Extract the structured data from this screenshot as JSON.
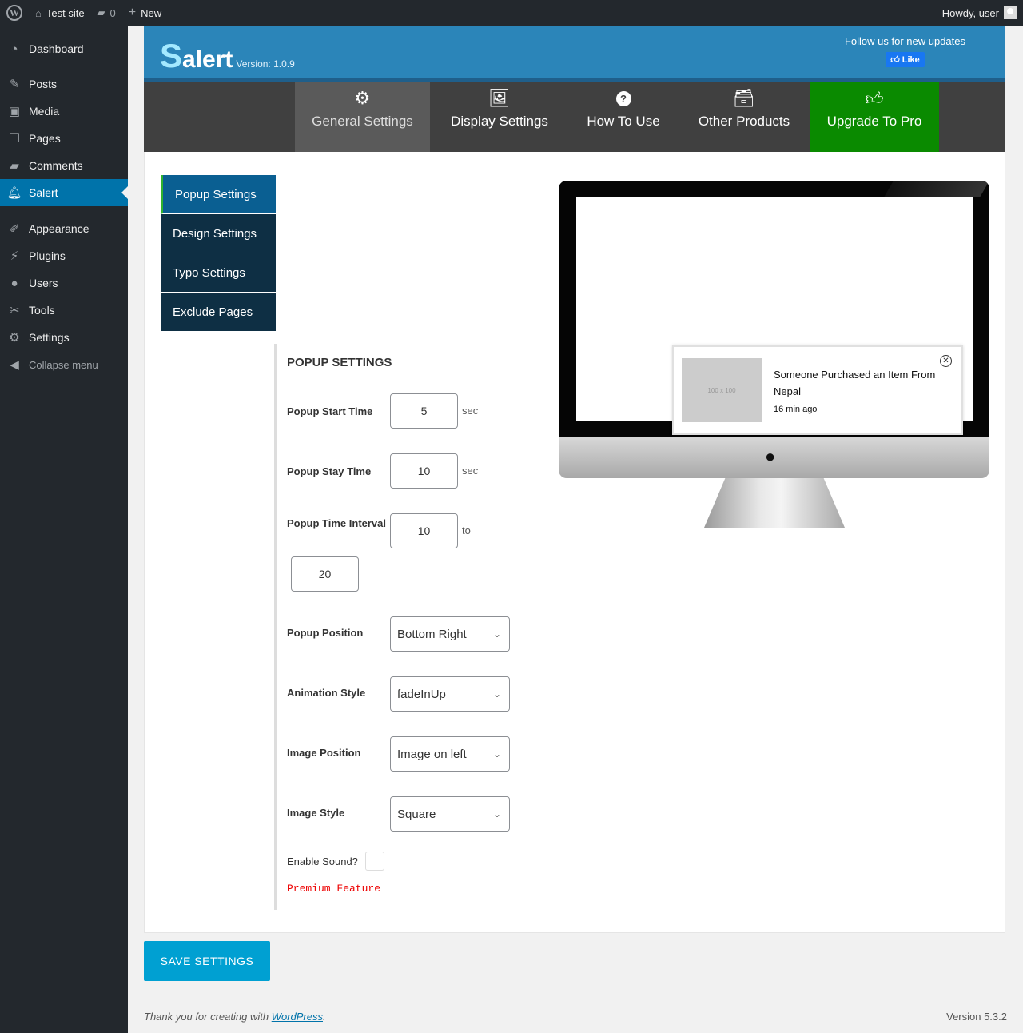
{
  "adminbar": {
    "site_name": "Test site",
    "comments_count": "0",
    "new_label": "New",
    "howdy": "Howdy, user"
  },
  "sidebar": {
    "items": [
      {
        "label": "Dashboard",
        "icon": "dashboard-icon"
      },
      {
        "label": "Posts",
        "icon": "pin-icon"
      },
      {
        "label": "Media",
        "icon": "media-icon"
      },
      {
        "label": "Pages",
        "icon": "pages-icon"
      },
      {
        "label": "Comments",
        "icon": "comment-icon"
      },
      {
        "label": "Salert",
        "icon": "bell-icon"
      },
      {
        "label": "Appearance",
        "icon": "brush-icon"
      },
      {
        "label": "Plugins",
        "icon": "plugin-icon"
      },
      {
        "label": "Users",
        "icon": "user-icon"
      },
      {
        "label": "Tools",
        "icon": "wrench-icon"
      },
      {
        "label": "Settings",
        "icon": "settings-icon"
      }
    ],
    "collapse": "Collapse menu"
  },
  "header": {
    "logo_first": "S",
    "logo_rest": "alert",
    "version": "Version: 1.0.9",
    "follow": "Follow us for new updates",
    "like": "Like"
  },
  "tabs": [
    {
      "label": "General Settings",
      "icon": "gear-icon"
    },
    {
      "label": "Display Settings",
      "icon": "image-icon"
    },
    {
      "label": "How To Use",
      "icon": "question-icon"
    },
    {
      "label": "Other Products",
      "icon": "archive-icon"
    },
    {
      "label": "Upgrade To Pro",
      "icon": "thumbs-up-icon"
    }
  ],
  "subnav": [
    "Popup Settings",
    "Design Settings",
    "Typo Settings",
    "Exclude Pages"
  ],
  "form": {
    "title": "POPUP SETTINGS",
    "start_time": {
      "label": "Popup Start Time",
      "value": "5",
      "unit": "sec"
    },
    "stay_time": {
      "label": "Popup Stay Time",
      "value": "10",
      "unit": "sec"
    },
    "interval": {
      "label": "Popup Time Interval",
      "from": "10",
      "unit": "to",
      "to": "20"
    },
    "position": {
      "label": "Popup Position",
      "value": "Bottom Right"
    },
    "animation": {
      "label": "Animation Style",
      "value": "fadeInUp"
    },
    "image_position": {
      "label": "Image Position",
      "value": "Image on left"
    },
    "image_style": {
      "label": "Image Style",
      "value": "Square"
    },
    "sound": {
      "label": "Enable Sound?"
    },
    "premium": "Premium Feature"
  },
  "preview": {
    "placeholder": "100 x 100",
    "message": "Someone Purchased an Item From Nepal",
    "time": "16 min ago"
  },
  "save_button": "SAVE SETTINGS",
  "footer": {
    "thanks_prefix": "Thank you for creating with ",
    "wordpress_link": "WordPress",
    "thanks_suffix": ".",
    "version": "Version 5.3.2"
  },
  "colors": {
    "accent": "#0073aa",
    "header_blue": "#2b85b9",
    "pro_green": "#0a8a00",
    "save_blue": "#00a0d2",
    "premium_red": "#ee0000"
  }
}
